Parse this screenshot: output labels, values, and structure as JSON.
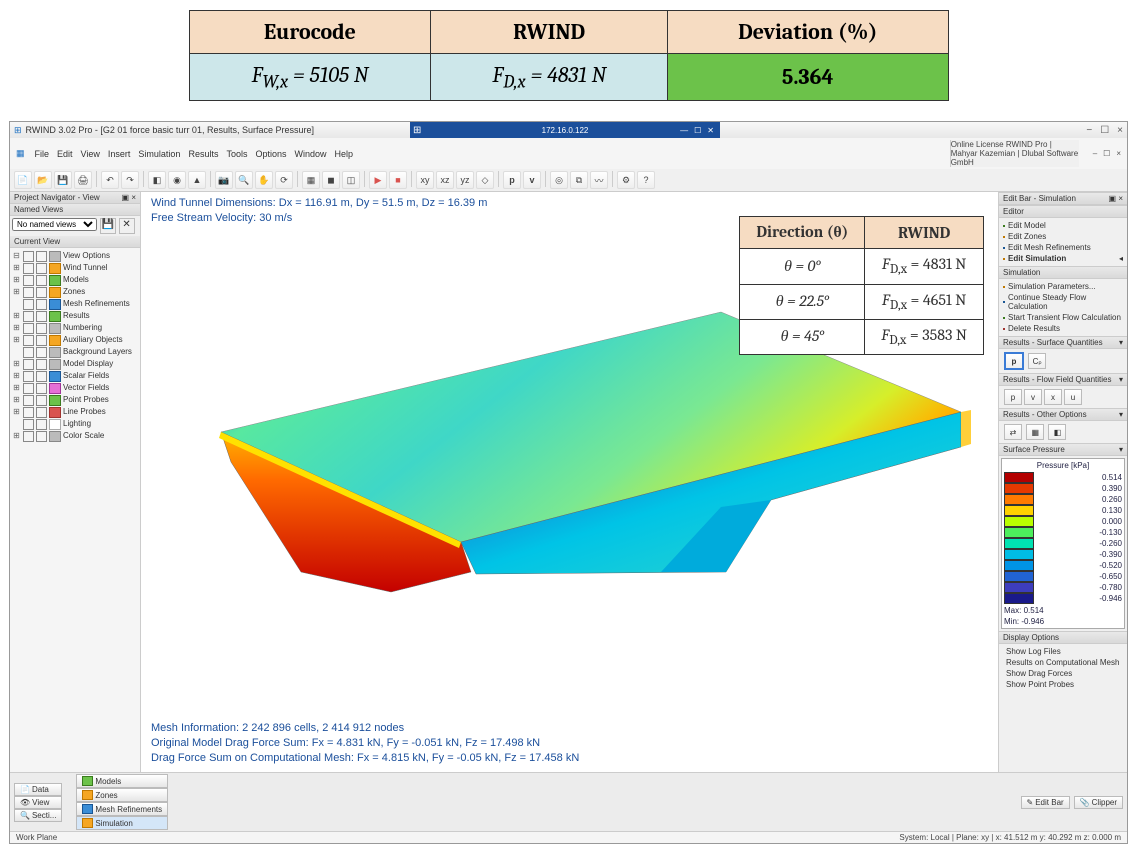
{
  "top_table": {
    "headers": [
      "Eurocode",
      "RWIND",
      "Deviation (%)"
    ],
    "euro_prefix": "F",
    "euro_sub": "W,x",
    "euro_val": " = 5105 N",
    "rwind_prefix": "F",
    "rwind_sub": "D,x",
    "rwind_val": " = 4831 N",
    "deviation": "5.364"
  },
  "titlebar": {
    "app_icon_text": "⊞",
    "title": "RWIND 3.02 Pro - [G2 01 force basic turr 01, Results, Surface Pressure]",
    "center_ip": "172.16.0.122",
    "min": "—",
    "max": "☐",
    "close": "✕",
    "sys_min": "−",
    "sys_close": "×"
  },
  "menubar": {
    "items": [
      "File",
      "Edit",
      "View",
      "Insert",
      "Simulation",
      "Results",
      "Tools",
      "Options",
      "Window",
      "Help"
    ],
    "right": "Online License RWIND Pro | Mahyar Kazemian | Dlubal Software GmbH",
    "doc_min": "–",
    "doc_max": "☐",
    "doc_close": "×"
  },
  "left_panel": {
    "nav_header": "Project Navigator - View",
    "nav_collapse": "▣ ×",
    "named_views_hdr": "Named Views",
    "named_views_sel": "No named views",
    "current_view_hdr": "Current View",
    "tree": [
      [
        "⊟",
        "grey",
        "View Options"
      ],
      [
        "⊞",
        "orange",
        "Wind Tunnel"
      ],
      [
        "⊞",
        "green",
        "Models"
      ],
      [
        "⊞",
        "orange",
        "Zones"
      ],
      [
        "",
        "blue",
        "Mesh Refinements"
      ],
      [
        "⊞",
        "green",
        "Results"
      ],
      [
        "⊞",
        "grey",
        "Numbering"
      ],
      [
        "⊞",
        "orange",
        "Auxiliary Objects"
      ],
      [
        "",
        "grey",
        "Background Layers"
      ],
      [
        "⊞",
        "grey",
        "Model Display"
      ],
      [
        "⊞",
        "blue",
        "Scalar Fields"
      ],
      [
        "⊞",
        "pink",
        "Vector Fields"
      ],
      [
        "⊞",
        "green",
        "Point Probes"
      ],
      [
        "⊞",
        "red",
        "Line Probes"
      ],
      [
        "",
        "white",
        "Lighting"
      ],
      [
        "⊞",
        "grey",
        "Color Scale"
      ]
    ]
  },
  "canvas": {
    "top1": "Wind Tunnel Dimensions: Dx = 116.91 m, Dy = 51.5 m, Dz = 16.39 m",
    "top2": "Free Stream Velocity: 30 m/s",
    "bot1": "Mesh Information: 2 242 896 cells, 2 414 912 nodes",
    "bot2": "Original Model Drag Force Sum: Fx = 4.831 kN, Fy = -0.051 kN, Fz = 17.498 kN",
    "bot3": "Drag Force Sum on Computational Mesh: Fx = 4.815 kN, Fy = -0.05 kN, Fz = 17.458 kN"
  },
  "dir_table": {
    "hdr_dir": "Direction (θ)",
    "hdr_rwind": "RWIND",
    "rows": [
      {
        "theta": "θ = 0°",
        "f_pre": "F",
        "f_sub": "D,x",
        "f_val": " = 4831 N"
      },
      {
        "theta": "θ = 22.5°",
        "f_pre": "F",
        "f_sub": "D,x",
        "f_val": " = 4651 N"
      },
      {
        "theta": "θ = 45°",
        "f_pre": "F",
        "f_sub": "D,x",
        "f_val": " = 3583 N"
      }
    ]
  },
  "right_panel": {
    "editbar_hdr": "Edit Bar - Simulation",
    "editbar_collapse": "▣ ×",
    "editor_hdr": "Editor",
    "editor_items": [
      "Edit Model",
      "Edit Zones",
      "Edit Mesh Refinements",
      "Edit Simulation"
    ],
    "sim_hdr": "Simulation",
    "sim_items": [
      "Simulation Parameters...",
      "Continue Steady Flow Calculation",
      "Start Transient Flow Calculation",
      "Delete Results"
    ],
    "surfq_hdr": "Results - Surface Quantities",
    "surfq_btn_p": "p",
    "surfq_btn_c": "Cₚ",
    "flowq_hdr": "Results - Flow Field Quantities",
    "flowq_btns": [
      "p",
      "v",
      "x",
      "u"
    ],
    "other_hdr": "Results - Other Options",
    "pressure_hdr": "Surface Pressure",
    "display_hdr": "Display Options",
    "display_items": [
      "Show Log Files",
      "Results on Computational Mesh",
      "Show Drag Forces",
      "Show Point Probes"
    ]
  },
  "legend": {
    "title": "Pressure [kPa]",
    "rows": [
      {
        "c": "#b30000",
        "v": "0.514"
      },
      {
        "c": "#e53900",
        "v": "0.390"
      },
      {
        "c": "#ff7a00",
        "v": "0.260"
      },
      {
        "c": "#ffd200",
        "v": "0.130"
      },
      {
        "c": "#baff00",
        "v": "0.000"
      },
      {
        "c": "#4dee5c",
        "v": "-0.130"
      },
      {
        "c": "#00e2b2",
        "v": "-0.260"
      },
      {
        "c": "#00bde4",
        "v": "-0.390"
      },
      {
        "c": "#0094e6",
        "v": "-0.520"
      },
      {
        "c": "#2163d4",
        "v": "-0.650"
      },
      {
        "c": "#3d3dbd",
        "v": "-0.780"
      },
      {
        "c": "#1a1a8a",
        "v": "-0.946"
      }
    ],
    "max_label": "Max:",
    "max_val": "0.514",
    "min_label": "Min:",
    "min_val": "-0.946"
  },
  "bottom_tabs": {
    "left": [
      {
        "icon": "📄",
        "label": "Data"
      },
      {
        "icon": "👁",
        "label": "View"
      },
      {
        "icon": "🔍",
        "label": "Secti..."
      }
    ],
    "center": [
      {
        "icon": "green",
        "label": "Models"
      },
      {
        "icon": "orange",
        "label": "Zones"
      },
      {
        "icon": "blue",
        "label": "Mesh Refinements"
      },
      {
        "icon": "orange",
        "label": "Simulation"
      }
    ],
    "right": [
      {
        "icon": "✎",
        "label": "Edit Bar"
      },
      {
        "icon": "📎",
        "label": "Clipper"
      }
    ]
  },
  "statusbar": {
    "left": "Work Plane",
    "right": "System: Local  |  Plane: xy  |  x: 41.512 m   y: 40.292 m   z: 0.000 m"
  }
}
